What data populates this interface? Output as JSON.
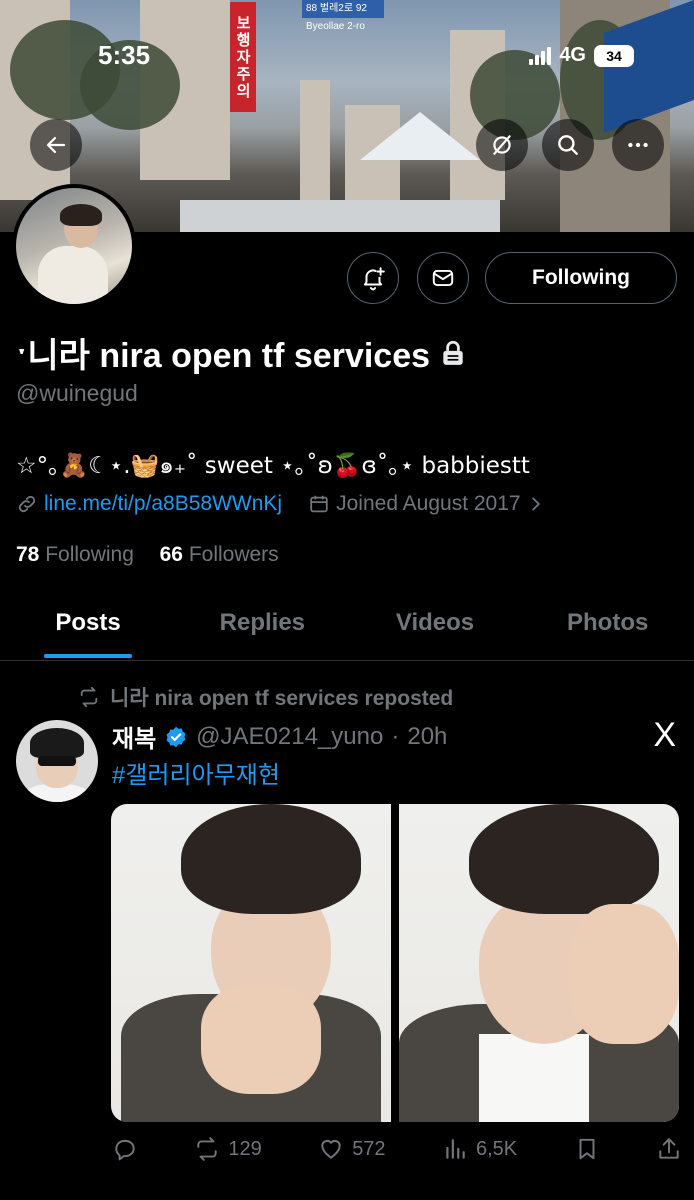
{
  "status_bar": {
    "time": "5:35",
    "network": "4G",
    "battery": "34"
  },
  "banner": {
    "sign_red": "보행자주의",
    "sign_blue": "88 벌레2로 92 Byeollae 2-ro"
  },
  "profile": {
    "display_name": "니라 nira open tf services",
    "name_prefix_mark": "ˑ",
    "handle": "@wuinegud",
    "bio": "☆°｡🧸☾⋆.🧺๑₊˚ sweet ⋆｡˚ʚ🍒ɞ˚｡⋆ babbiestt",
    "link": "line.me/ti/p/a8B58WWnKj",
    "joined": "Joined August 2017",
    "following_count": "78",
    "following_label": "Following",
    "followers_count": "66",
    "followers_label": "Followers",
    "follow_button": "Following"
  },
  "tabs": [
    {
      "label": "Posts",
      "active": true
    },
    {
      "label": "Replies",
      "active": false
    },
    {
      "label": "Videos",
      "active": false
    },
    {
      "label": "Photos",
      "active": false
    }
  ],
  "post": {
    "repost_label": "니라 nira open tf services reposted",
    "author_name": "재복",
    "author_handle": "@JAE0214_yuno",
    "separator": "·",
    "time": "20h",
    "text": "#갤러리아무재현",
    "source_logo": "X",
    "retweets": "129",
    "likes": "572",
    "views": "6,5K"
  },
  "colors": {
    "accent": "#1d9bf0",
    "secondary_text": "#71767b",
    "background": "#000000",
    "border": "#2f3336"
  }
}
